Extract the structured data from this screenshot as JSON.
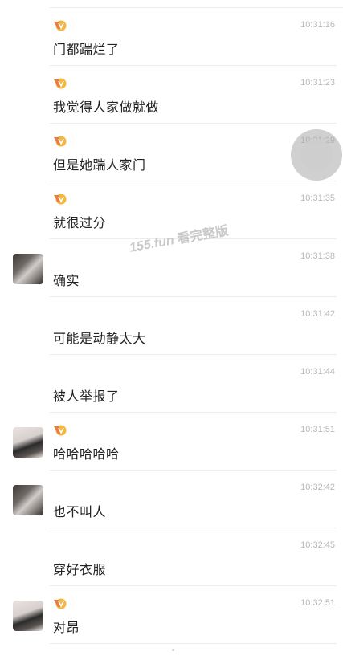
{
  "messages": [
    {
      "avatar": "",
      "badge": true,
      "time": "10:31:16",
      "text": "门都踹烂了"
    },
    {
      "avatar": "",
      "badge": true,
      "time": "10:31:23",
      "text": "我觉得人家做就做"
    },
    {
      "avatar": "",
      "badge": true,
      "time": "10:31:29",
      "text": "但是她踹人家门"
    },
    {
      "avatar": "",
      "badge": true,
      "time": "10:31:35",
      "text": "就很过分"
    },
    {
      "avatar": "cat",
      "badge": false,
      "time": "10:31:38",
      "text": "确实"
    },
    {
      "avatar": "",
      "badge": false,
      "time": "10:31:42",
      "text": "可能是动静太大"
    },
    {
      "avatar": "",
      "badge": false,
      "time": "10:31:44",
      "text": "被人举报了"
    },
    {
      "avatar": "girl",
      "badge": true,
      "time": "10:31:51",
      "text": "哈哈哈哈哈"
    },
    {
      "avatar": "cat",
      "badge": false,
      "time": "10:32:42",
      "text": "也不叫人"
    },
    {
      "avatar": "",
      "badge": false,
      "time": "10:32:45",
      "text": "穿好衣服"
    },
    {
      "avatar": "girl",
      "badge": true,
      "time": "10:32:51",
      "text": "对昂"
    }
  ],
  "watermark": {
    "num": "155.fun",
    "text": "看完整版"
  },
  "colors": {
    "badge_orange": "#e87d3e",
    "badge_yellow": "#f4b63f",
    "time": "#b8b8b8"
  }
}
